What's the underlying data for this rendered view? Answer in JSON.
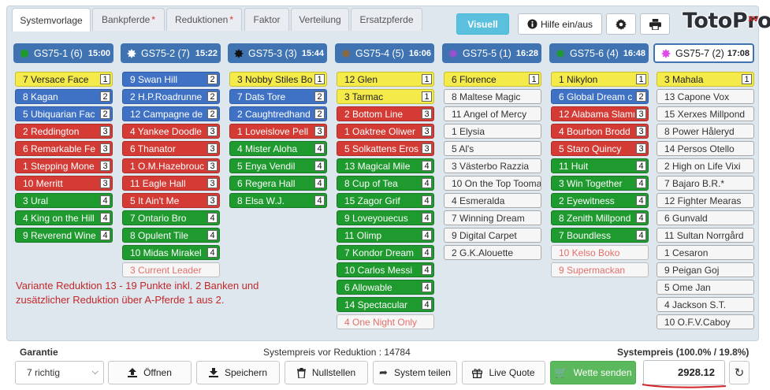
{
  "tabs": [
    {
      "label": "Systemvorlage",
      "star": ""
    },
    {
      "label": "Bankpferde",
      "star": "*"
    },
    {
      "label": "Reduktionen",
      "star": "*"
    },
    {
      "label": "Faktor",
      "star": ""
    },
    {
      "label": "Verteilung",
      "star": ""
    },
    {
      "label": "Ersatzpferde",
      "star": ""
    }
  ],
  "toolbar": {
    "visual_label": "Visuell",
    "help_label": "Hilfe ein/aus",
    "info_icon": "info-circle-icon",
    "settings_icon": "gear-icon",
    "print_icon": "printer-icon"
  },
  "logo": {
    "text": "TotoPro",
    "badge": "XV"
  },
  "races": [
    {
      "name": "GS75-1 (6)",
      "time": "15:00",
      "dot": "#1e9a2e",
      "dot_shape": "circle"
    },
    {
      "name": "GS75-2 (7)",
      "time": "15:22",
      "dot": "#ffffff",
      "dot_shape": "star"
    },
    {
      "name": "GS75-3 (3)",
      "time": "15:44",
      "dot": "#111111",
      "dot_shape": "star"
    },
    {
      "name": "GS75-4 (5)",
      "time": "16:06",
      "dot": "#8a6a3d",
      "dot_shape": "star"
    },
    {
      "name": "GS75-5 (1)",
      "time": "16:28",
      "dot": "#9b4fd1",
      "dot_shape": "star"
    },
    {
      "name": "GS75-6 (4)",
      "time": "16:48",
      "dot": "#1e9a2e",
      "dot_shape": "star"
    },
    {
      "name": "GS75-7 (2)",
      "time": "17:08",
      "dot": "#e04ae6",
      "dot_shape": "star"
    }
  ],
  "columns": [
    [
      {
        "name": "7 Versace Face",
        "badge": "1",
        "color": "yellow"
      },
      {
        "name": "8 Kagan",
        "badge": "2",
        "color": "blue"
      },
      {
        "name": "5 Ubiquarian Fac",
        "badge": "2",
        "color": "blue"
      },
      {
        "name": "2 Reddington",
        "badge": "3",
        "color": "red"
      },
      {
        "name": "6 Remarkable Fe",
        "badge": "3",
        "color": "red"
      },
      {
        "name": "1 Stepping Mone",
        "badge": "3",
        "color": "red"
      },
      {
        "name": "10 Merritt",
        "badge": "3",
        "color": "red"
      },
      {
        "name": "3 Ural",
        "badge": "4",
        "color": "green"
      },
      {
        "name": "4 King on the Hill",
        "badge": "4",
        "color": "green"
      },
      {
        "name": "9 Reverend Wine",
        "badge": "4",
        "color": "green"
      }
    ],
    [
      {
        "name": "9 Swan Hill",
        "badge": "2",
        "color": "blue"
      },
      {
        "name": "2 H.P.Roadrunne",
        "badge": "2",
        "color": "blue"
      },
      {
        "name": "12 Campagne de l",
        "badge": "2",
        "color": "blue"
      },
      {
        "name": "4 Yankee Doodle",
        "badge": "3",
        "color": "red"
      },
      {
        "name": "6 Thanator",
        "badge": "3",
        "color": "red"
      },
      {
        "name": "1 O.M.Hazebrouc",
        "badge": "3",
        "color": "red"
      },
      {
        "name": "11 Eagle Hall",
        "badge": "3",
        "color": "red"
      },
      {
        "name": "5 It Ain't Me",
        "badge": "3",
        "color": "red"
      },
      {
        "name": "7 Ontario Bro",
        "badge": "4",
        "color": "green"
      },
      {
        "name": "8 Opulent Tile",
        "badge": "4",
        "color": "green"
      },
      {
        "name": "10 Midas Mirakel",
        "badge": "4",
        "color": "green"
      },
      {
        "name": "3 Current Leader",
        "badge": "",
        "color": "white-red"
      }
    ],
    [
      {
        "name": "3 Nobby Stiles Bo",
        "badge": "1",
        "color": "yellow"
      },
      {
        "name": "7 Dats Tore",
        "badge": "2",
        "color": "blue"
      },
      {
        "name": "2 Caughtredhand",
        "badge": "2",
        "color": "blue"
      },
      {
        "name": "1 Loveislove Pell",
        "badge": "3",
        "color": "red"
      },
      {
        "name": "4 Mister Aloha",
        "badge": "4",
        "color": "green"
      },
      {
        "name": "5 Enya Vendil",
        "badge": "4",
        "color": "green"
      },
      {
        "name": "6 Regera Hall",
        "badge": "4",
        "color": "green"
      },
      {
        "name": "8 Elsa W.J.",
        "badge": "4",
        "color": "green"
      }
    ],
    [
      {
        "name": "12 Glen",
        "badge": "1",
        "color": "yellow"
      },
      {
        "name": "3 Tarmac",
        "badge": "1",
        "color": "yellow"
      },
      {
        "name": "2 Bottom Line",
        "badge": "3",
        "color": "red"
      },
      {
        "name": "1 Oaktree Oliwer",
        "badge": "3",
        "color": "red"
      },
      {
        "name": "5 Solkattens Eros",
        "badge": "3",
        "color": "red"
      },
      {
        "name": "13 Magical Mile",
        "badge": "4",
        "color": "green"
      },
      {
        "name": "8 Cup of Tea",
        "badge": "4",
        "color": "green"
      },
      {
        "name": "15 Zagor Grif",
        "badge": "4",
        "color": "green"
      },
      {
        "name": "9 Loveyouecus",
        "badge": "4",
        "color": "green"
      },
      {
        "name": "11 Olimp",
        "badge": "4",
        "color": "green"
      },
      {
        "name": "7 Kondor Dream",
        "badge": "4",
        "color": "green"
      },
      {
        "name": "10 Carlos Messi",
        "badge": "4",
        "color": "green"
      },
      {
        "name": "6 Allowable",
        "badge": "4",
        "color": "green"
      },
      {
        "name": "14 Spectacular",
        "badge": "4",
        "color": "green"
      },
      {
        "name": "4 One Night Only",
        "badge": "",
        "color": "white-red"
      }
    ],
    [
      {
        "name": "6 Florence",
        "badge": "1",
        "color": "yellow"
      },
      {
        "name": "8 Maltese Magic",
        "badge": "",
        "color": "white"
      },
      {
        "name": "11 Angel of Mercy",
        "badge": "",
        "color": "white"
      },
      {
        "name": "1 Elysia",
        "badge": "",
        "color": "white"
      },
      {
        "name": "5 Al's",
        "badge": "",
        "color": "white"
      },
      {
        "name": "3 Västerbo Razzia",
        "badge": "",
        "color": "white"
      },
      {
        "name": "10 On the Top Tooma",
        "badge": "",
        "color": "white"
      },
      {
        "name": "4 Esmeralda",
        "badge": "",
        "color": "white"
      },
      {
        "name": "7 Winning Dream",
        "badge": "",
        "color": "white"
      },
      {
        "name": "9 Digital Carpet",
        "badge": "",
        "color": "white"
      },
      {
        "name": "2 G.K.Alouette",
        "badge": "",
        "color": "white"
      }
    ],
    [
      {
        "name": "1 Nikylon",
        "badge": "1",
        "color": "yellow"
      },
      {
        "name": "6 Global Dream c",
        "badge": "2",
        "color": "blue"
      },
      {
        "name": "12 Alabama Slamm",
        "badge": "3",
        "color": "red"
      },
      {
        "name": "4 Bourbon Brodd",
        "badge": "3",
        "color": "red"
      },
      {
        "name": "5 Staro Quincy",
        "badge": "3",
        "color": "red"
      },
      {
        "name": "11 Huit",
        "badge": "4",
        "color": "green"
      },
      {
        "name": "3 Win Together",
        "badge": "4",
        "color": "green"
      },
      {
        "name": "2 Eyewitness",
        "badge": "4",
        "color": "green"
      },
      {
        "name": "8 Zenith Millpond",
        "badge": "4",
        "color": "green"
      },
      {
        "name": "7 Boundless",
        "badge": "4",
        "color": "green"
      },
      {
        "name": "10 Kelso Boko",
        "badge": "",
        "color": "white-red"
      },
      {
        "name": "9 Supermackan",
        "badge": "",
        "color": "white-red"
      }
    ],
    [
      {
        "name": "3 Mahala",
        "badge": "1",
        "color": "yellow"
      },
      {
        "name": "13 Capone Vox",
        "badge": "",
        "color": "white"
      },
      {
        "name": "15 Xerxes Millpond",
        "badge": "",
        "color": "white"
      },
      {
        "name": "8 Power Håleryd",
        "badge": "",
        "color": "white"
      },
      {
        "name": "14 Persos Otello",
        "badge": "",
        "color": "white"
      },
      {
        "name": "2 High on Life Vixi",
        "badge": "",
        "color": "white"
      },
      {
        "name": "7 Bajaro B.R.*",
        "badge": "",
        "color": "white"
      },
      {
        "name": "12 Fighter Mearas",
        "badge": "",
        "color": "white"
      },
      {
        "name": "6 Gunvald",
        "badge": "",
        "color": "white"
      },
      {
        "name": "11 Sultan Norrgård",
        "badge": "",
        "color": "white"
      },
      {
        "name": "1 Cesaron",
        "badge": "",
        "color": "white"
      },
      {
        "name": "9 Peigan Goj",
        "badge": "",
        "color": "white"
      },
      {
        "name": "5 Ome Jan",
        "badge": "",
        "color": "white"
      },
      {
        "name": "4 Jackson S.T.",
        "badge": "",
        "color": "white"
      },
      {
        "name": "10 O.F.V.Caboy",
        "badge": "",
        "color": "white"
      }
    ]
  ],
  "note": {
    "line1": "Variante Reduktion 13 - 19 Punkte inkl. 2 Banken und",
    "line2": "zusätzlicher Reduktion über A-Pferde 1 aus 2."
  },
  "footer": {
    "guarantee_label": "Garantie",
    "guarantee_value": "7 richtig",
    "price_before": "Systempreis vor Reduktion : 14784",
    "price_label": "Systempreis (100.0% / 19.8%)",
    "price_value": "2928.12",
    "buttons": {
      "open": "Öffnen",
      "save": "Speichern",
      "reset": "Nullstellen",
      "share": "System teilen",
      "live": "Live Quote",
      "send": "Wette senden"
    }
  },
  "colors": {
    "yellow": "#f4ea4a",
    "blue": "#3f72c4",
    "red": "#d43b35",
    "green": "#1e9a2e",
    "race_header": "#3f73b1",
    "note": "#c2282a",
    "underline": "#d2262a"
  }
}
